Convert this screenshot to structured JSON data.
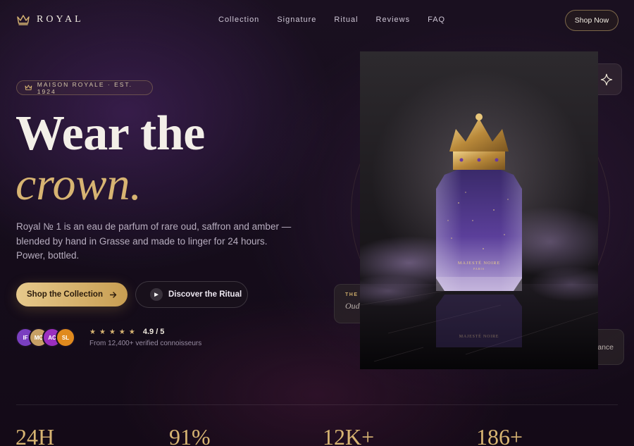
{
  "nav": {
    "brand": "ROYAL",
    "links": [
      "Collection",
      "Signature",
      "Ritual",
      "Reviews",
      "FAQ"
    ],
    "cta": "Shop Now"
  },
  "hero": {
    "badge": "MAISON ROYALE · EST. 1924",
    "headline_line1": "Wear the",
    "headline_line2": "crown.",
    "lede": "Royal № 1 is an eau de parfum of rare oud, saffron and amber — blended by hand in Grasse and made to linger for 24 hours. Power, bottled.",
    "primary_cta": "Shop the Collection",
    "secondary_cta": "Discover the Ritual",
    "avatars": [
      {
        "initials": "IF",
        "color": "#7a3fc0"
      },
      {
        "initials": "MC",
        "color": "#c7a065"
      },
      {
        "initials": "AC",
        "color": "#9b2fbf"
      },
      {
        "initials": "SL",
        "color": "#e08a1e"
      }
    ],
    "rating_stars": 5,
    "rating_score": "4.9 / 5",
    "rating_sub": "From 12,400+ verified connoisseurs"
  },
  "visual": {
    "card_left_tag": "THE",
    "card_left_value": "Oud",
    "card_right_value": "rance",
    "bottle_label": "MAJESTÉ NOIRE",
    "bottle_sublabel": "PARIS",
    "reflection_label": "MAJESTÉ NOIRE"
  },
  "stats": [
    "24H",
    "91%",
    "12K+",
    "186+"
  ],
  "colors": {
    "accent_gold": "#d7b472",
    "background": "#1a1020",
    "text_primary": "#f3efe8"
  },
  "icons": {
    "brand": "crown-icon",
    "badge": "crown-icon",
    "primary_cta": "arrow-right-icon",
    "secondary_cta": "play-icon",
    "float_top": "sparkle-icon",
    "rating": "star-icon"
  }
}
